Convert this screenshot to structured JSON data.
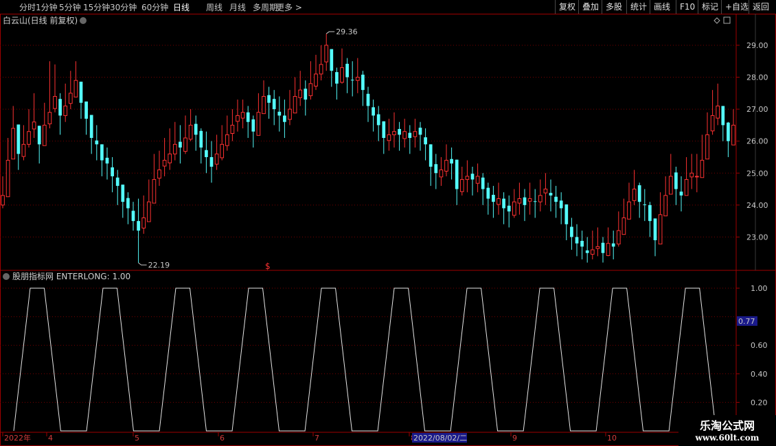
{
  "toolbar": {
    "periods": [
      "分时",
      "1分钟",
      "5分钟",
      "15分钟",
      "30分钟",
      "60分钟",
      "日线",
      "周线",
      "月线",
      "多周期",
      "更多 >"
    ],
    "active_period": "日线",
    "right_buttons": [
      "复权",
      "叠加",
      "多股",
      "统计",
      "画线",
      "F10",
      "标记",
      "+自选",
      "返回"
    ]
  },
  "price_panel": {
    "stock_title": "白云山(日线 前复权)",
    "y_ticks": [
      "29.00",
      "28.00",
      "27.00",
      "26.00",
      "25.00",
      "24.00",
      "23.00"
    ],
    "high_label": "29.36",
    "low_label": "22.19",
    "marker_symbol": "$",
    "colors": {
      "up": "#ff3232",
      "down": "#54fcfc",
      "grid": "#7a0000",
      "border": "#a00000"
    }
  },
  "indicator_panel": {
    "title": "股朋指标网 ENTERLONG: 1.00",
    "y_ticks": [
      "1.00",
      "0.60",
      "0.40",
      "0.20"
    ],
    "cursor_value": "0.77"
  },
  "date_axis": {
    "labels": [
      "2022年",
      "4",
      "5",
      "6",
      "7",
      "8",
      "9",
      "10"
    ],
    "cursor_date": "2022/08/02/二"
  },
  "watermark": {
    "title": "乐淘公式网",
    "url": "www.60lt.com"
  },
  "chart_data": {
    "type": "candlestick",
    "title": "白云山(日线 前复权)",
    "ylim": [
      22.0,
      29.6
    ],
    "closes": [
      24.3,
      25.4,
      26.4,
      25.6,
      25.9,
      26.3,
      26.6,
      25.9,
      26.5,
      26.9,
      27.4,
      26.8,
      27.1,
      27.5,
      27.9,
      27.2,
      26.7,
      26.1,
      25.9,
      25.4,
      25.3,
      24.9,
      24.6,
      24.1,
      23.9,
      23.5,
      23.2,
      23.6,
      24.1,
      24.8,
      25.1,
      25.4,
      25.6,
      25.9,
      25.8,
      26.1,
      26.5,
      26.2,
      25.8,
      25.5,
      25.2,
      25.6,
      25.9,
      26.2,
      26.5,
      26.8,
      26.9,
      26.6,
      26.3,
      26.9,
      27.4,
      27.2,
      27.0,
      26.8,
      26.6,
      27.0,
      27.4,
      27.6,
      27.3,
      27.8,
      28.1,
      28.4,
      29.0,
      28.2,
      27.8,
      28.3,
      28.0,
      27.9,
      28.0,
      27.6,
      27.1,
      26.8,
      26.5,
      26.1,
      26.2,
      26.3,
      26.2,
      26.3,
      26.1,
      26.3,
      26.2,
      25.9,
      25.2,
      25.0,
      25.1,
      25.4,
      25.3,
      24.5,
      24.8,
      24.9,
      24.8,
      24.9,
      24.5,
      24.2,
      24.1,
      24.2,
      23.9,
      23.8,
      24.1,
      24.2,
      24.0,
      24.2,
      24.1,
      24.3,
      24.5,
      24.3,
      24.1,
      23.9,
      23.4,
      23.0,
      22.8,
      22.7,
      22.5,
      22.6,
      22.7,
      22.5,
      22.8,
      22.7,
      23.2,
      23.6,
      24.1,
      24.5,
      24.1,
      24.0,
      23.5,
      22.9,
      23.7,
      24.3,
      24.9,
      24.5,
      24.3,
      24.8,
      25.0,
      24.9,
      25.4,
      26.2,
      26.8,
      27.1,
      26.5,
      26.0,
      26.5
    ],
    "highs": [
      24.9,
      26.1,
      27.1,
      26.4,
      26.5,
      27.0,
      27.5,
      26.4,
      27.2,
      28.5,
      28.4,
      27.5,
      27.8,
      28.2,
      28.5,
      27.8,
      27.2,
      26.7,
      26.5,
      25.9,
      25.8,
      25.5,
      25.1,
      24.6,
      24.4,
      24.1,
      24.2,
      24.3,
      24.8,
      25.6,
      25.7,
      26.1,
      26.4,
      26.6,
      26.5,
      26.8,
      27.0,
      26.8,
      26.4,
      26.3,
      26.0,
      26.2,
      26.5,
      26.8,
      27.0,
      27.3,
      27.3,
      27.1,
      26.8,
      27.5,
      27.9,
      27.7,
      27.6,
      27.4,
      27.3,
      27.6,
      28.0,
      28.2,
      27.9,
      28.5,
      28.7,
      29.0,
      29.36,
      28.8,
      28.3,
      28.9,
      28.6,
      28.5,
      28.6,
      28.2,
      27.7,
      27.3,
      27.1,
      26.6,
      26.7,
      26.9,
      26.6,
      26.7,
      26.5,
      26.7,
      26.6,
      26.4,
      25.7,
      25.6,
      25.5,
      25.9,
      25.8,
      25.1,
      25.2,
      25.4,
      25.2,
      25.3,
      25.0,
      24.7,
      24.6,
      24.7,
      24.4,
      24.3,
      24.5,
      24.7,
      24.5,
      24.7,
      24.5,
      24.8,
      25.0,
      24.8,
      24.6,
      24.4,
      23.9,
      23.6,
      23.4,
      23.2,
      23.0,
      23.2,
      23.3,
      23.0,
      23.3,
      23.2,
      23.8,
      24.2,
      24.7,
      25.1,
      24.7,
      24.5,
      24.1,
      23.5,
      24.4,
      24.9,
      25.6,
      25.2,
      24.9,
      25.5,
      25.6,
      25.6,
      26.2,
      26.9,
      27.6,
      27.8,
      27.0,
      26.6,
      27.0
    ],
    "lows": [
      23.9,
      24.9,
      25.9,
      25.1,
      25.4,
      25.8,
      26.1,
      25.3,
      26.0,
      26.4,
      26.9,
      26.2,
      26.6,
      27.0,
      27.4,
      26.7,
      26.2,
      25.6,
      25.4,
      24.9,
      24.8,
      24.4,
      24.0,
      23.6,
      23.4,
      23.2,
      22.19,
      23.1,
      23.6,
      24.3,
      24.6,
      24.9,
      25.1,
      25.4,
      25.3,
      25.6,
      26.0,
      25.7,
      25.3,
      25.0,
      24.7,
      25.1,
      25.4,
      25.7,
      26.0,
      26.3,
      26.4,
      26.1,
      25.8,
      26.4,
      26.9,
      26.7,
      26.5,
      26.3,
      26.1,
      26.5,
      26.9,
      27.1,
      26.8,
      27.3,
      27.6,
      27.9,
      28.2,
      27.7,
      27.3,
      27.8,
      27.5,
      27.4,
      27.5,
      27.1,
      26.6,
      26.3,
      26.0,
      25.6,
      25.7,
      25.8,
      25.7,
      25.8,
      25.6,
      25.8,
      25.7,
      25.4,
      24.6,
      24.5,
      24.6,
      24.9,
      24.8,
      24.0,
      24.3,
      24.4,
      24.3,
      24.4,
      24.0,
      23.7,
      23.6,
      23.7,
      23.4,
      23.3,
      23.6,
      23.7,
      23.5,
      23.7,
      23.6,
      23.8,
      24.0,
      23.8,
      23.6,
      23.4,
      22.9,
      22.6,
      22.4,
      22.3,
      22.2,
      22.3,
      22.4,
      22.2,
      22.4,
      22.3,
      22.7,
      23.1,
      23.6,
      24.0,
      23.6,
      23.5,
      23.0,
      22.4,
      23.2,
      23.8,
      24.4,
      24.0,
      23.8,
      24.3,
      24.5,
      24.4,
      24.9,
      25.7,
      26.2,
      26.5,
      26.0,
      25.5,
      26.0
    ],
    "indicator_period": 9,
    "indicator_range": [
      0,
      1
    ]
  }
}
